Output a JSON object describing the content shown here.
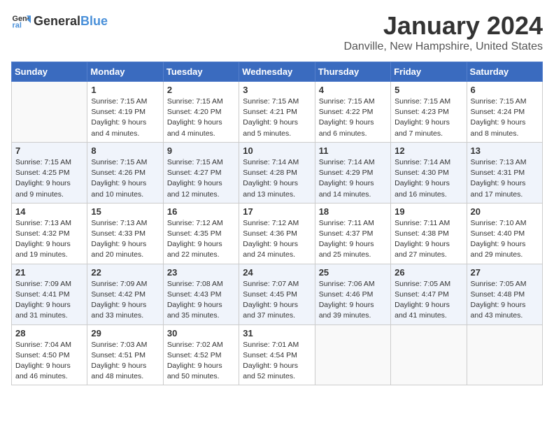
{
  "logo": {
    "general": "General",
    "blue": "Blue"
  },
  "title": "January 2024",
  "location": "Danville, New Hampshire, United States",
  "weekdays": [
    "Sunday",
    "Monday",
    "Tuesday",
    "Wednesday",
    "Thursday",
    "Friday",
    "Saturday"
  ],
  "weeks": [
    [
      {
        "day": null
      },
      {
        "day": "1",
        "sunrise": "7:15 AM",
        "sunset": "4:19 PM",
        "daylight": "9 hours and 4 minutes."
      },
      {
        "day": "2",
        "sunrise": "7:15 AM",
        "sunset": "4:20 PM",
        "daylight": "9 hours and 4 minutes."
      },
      {
        "day": "3",
        "sunrise": "7:15 AM",
        "sunset": "4:21 PM",
        "daylight": "9 hours and 5 minutes."
      },
      {
        "day": "4",
        "sunrise": "7:15 AM",
        "sunset": "4:22 PM",
        "daylight": "9 hours and 6 minutes."
      },
      {
        "day": "5",
        "sunrise": "7:15 AM",
        "sunset": "4:23 PM",
        "daylight": "9 hours and 7 minutes."
      },
      {
        "day": "6",
        "sunrise": "7:15 AM",
        "sunset": "4:24 PM",
        "daylight": "9 hours and 8 minutes."
      }
    ],
    [
      {
        "day": "7",
        "sunrise": "7:15 AM",
        "sunset": "4:25 PM",
        "daylight": "9 hours and 9 minutes."
      },
      {
        "day": "8",
        "sunrise": "7:15 AM",
        "sunset": "4:26 PM",
        "daylight": "9 hours and 10 minutes."
      },
      {
        "day": "9",
        "sunrise": "7:15 AM",
        "sunset": "4:27 PM",
        "daylight": "9 hours and 12 minutes."
      },
      {
        "day": "10",
        "sunrise": "7:14 AM",
        "sunset": "4:28 PM",
        "daylight": "9 hours and 13 minutes."
      },
      {
        "day": "11",
        "sunrise": "7:14 AM",
        "sunset": "4:29 PM",
        "daylight": "9 hours and 14 minutes."
      },
      {
        "day": "12",
        "sunrise": "7:14 AM",
        "sunset": "4:30 PM",
        "daylight": "9 hours and 16 minutes."
      },
      {
        "day": "13",
        "sunrise": "7:13 AM",
        "sunset": "4:31 PM",
        "daylight": "9 hours and 17 minutes."
      }
    ],
    [
      {
        "day": "14",
        "sunrise": "7:13 AM",
        "sunset": "4:32 PM",
        "daylight": "9 hours and 19 minutes."
      },
      {
        "day": "15",
        "sunrise": "7:13 AM",
        "sunset": "4:33 PM",
        "daylight": "9 hours and 20 minutes."
      },
      {
        "day": "16",
        "sunrise": "7:12 AM",
        "sunset": "4:35 PM",
        "daylight": "9 hours and 22 minutes."
      },
      {
        "day": "17",
        "sunrise": "7:12 AM",
        "sunset": "4:36 PM",
        "daylight": "9 hours and 24 minutes."
      },
      {
        "day": "18",
        "sunrise": "7:11 AM",
        "sunset": "4:37 PM",
        "daylight": "9 hours and 25 minutes."
      },
      {
        "day": "19",
        "sunrise": "7:11 AM",
        "sunset": "4:38 PM",
        "daylight": "9 hours and 27 minutes."
      },
      {
        "day": "20",
        "sunrise": "7:10 AM",
        "sunset": "4:40 PM",
        "daylight": "9 hours and 29 minutes."
      }
    ],
    [
      {
        "day": "21",
        "sunrise": "7:09 AM",
        "sunset": "4:41 PM",
        "daylight": "9 hours and 31 minutes."
      },
      {
        "day": "22",
        "sunrise": "7:09 AM",
        "sunset": "4:42 PM",
        "daylight": "9 hours and 33 minutes."
      },
      {
        "day": "23",
        "sunrise": "7:08 AM",
        "sunset": "4:43 PM",
        "daylight": "9 hours and 35 minutes."
      },
      {
        "day": "24",
        "sunrise": "7:07 AM",
        "sunset": "4:45 PM",
        "daylight": "9 hours and 37 minutes."
      },
      {
        "day": "25",
        "sunrise": "7:06 AM",
        "sunset": "4:46 PM",
        "daylight": "9 hours and 39 minutes."
      },
      {
        "day": "26",
        "sunrise": "7:05 AM",
        "sunset": "4:47 PM",
        "daylight": "9 hours and 41 minutes."
      },
      {
        "day": "27",
        "sunrise": "7:05 AM",
        "sunset": "4:48 PM",
        "daylight": "9 hours and 43 minutes."
      }
    ],
    [
      {
        "day": "28",
        "sunrise": "7:04 AM",
        "sunset": "4:50 PM",
        "daylight": "9 hours and 46 minutes."
      },
      {
        "day": "29",
        "sunrise": "7:03 AM",
        "sunset": "4:51 PM",
        "daylight": "9 hours and 48 minutes."
      },
      {
        "day": "30",
        "sunrise": "7:02 AM",
        "sunset": "4:52 PM",
        "daylight": "9 hours and 50 minutes."
      },
      {
        "day": "31",
        "sunrise": "7:01 AM",
        "sunset": "4:54 PM",
        "daylight": "9 hours and 52 minutes."
      },
      {
        "day": null
      },
      {
        "day": null
      },
      {
        "day": null
      }
    ]
  ]
}
